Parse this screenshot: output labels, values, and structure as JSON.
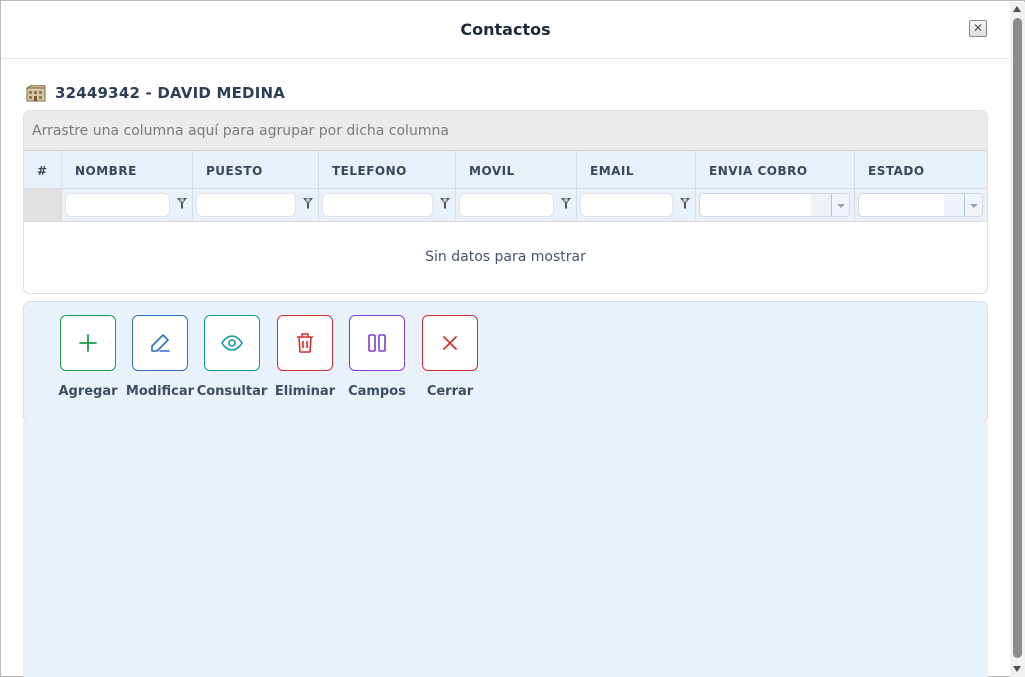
{
  "window": {
    "title": "Contactos"
  },
  "client": {
    "heading": "32449342 - DAVID MEDINA"
  },
  "grid": {
    "group_panel_text": "Arrastre una columna aquí para agrupar por dicha columna",
    "columns": [
      "#",
      "NOMBRE",
      "PUESTO",
      "TELEFONO",
      "MOVIL",
      "EMAIL",
      "ENVIA COBRO",
      "ESTADO"
    ],
    "empty_text": "Sin datos para mostrar"
  },
  "actions": [
    {
      "label": "Agregar",
      "icon": "plus-icon",
      "color": "#1e9a4a"
    },
    {
      "label": "Modificar",
      "icon": "pencil-icon",
      "color": "#2f6fc5"
    },
    {
      "label": "Consultar",
      "icon": "eye-icon",
      "color": "#1596a8"
    },
    {
      "label": "Eliminar",
      "icon": "trash-icon",
      "color": "#d32f2f"
    },
    {
      "label": "Campos",
      "icon": "columns-icon",
      "color": "#7e3fd0"
    },
    {
      "label": "Cerrar",
      "icon": "x-icon",
      "color": "#d32f2f"
    }
  ]
}
